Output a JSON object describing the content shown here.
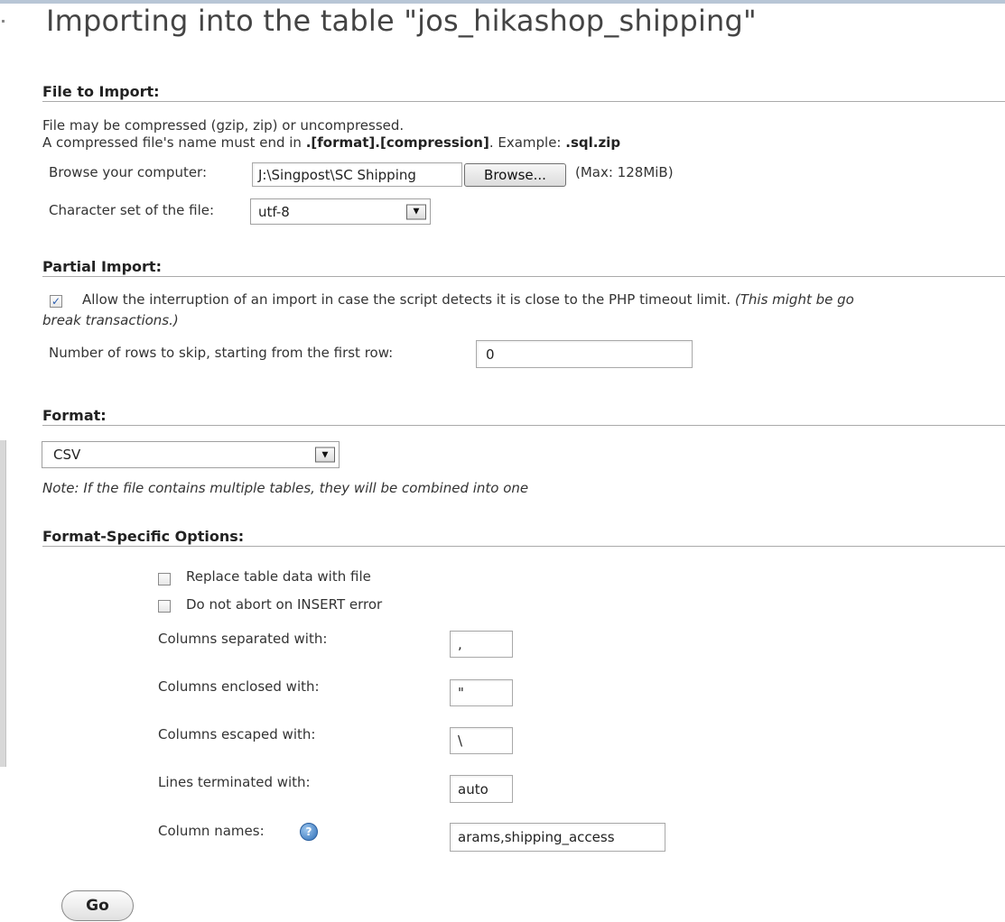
{
  "page_title": "Importing into the table \"jos_hikashop_shipping\"",
  "file_to_import": {
    "heading": "File to Import:",
    "line1": "File may be compressed (gzip, zip) or uncompressed.",
    "line2_prefix": "A compressed file's name must end in ",
    "line2_format": ".[format].[compression]",
    "line2_mid": ". Example: ",
    "line2_example": ".sql.zip",
    "browse_label": "Browse your computer:",
    "file_path": "J:\\Singpost\\SC Shipping",
    "browse_button": "Browse...",
    "max_size": "(Max: 128MiB)",
    "charset_label": "Character set of the file:",
    "charset_value": "utf-8"
  },
  "partial_import": {
    "heading": "Partial Import:",
    "allow_interruption_checked": true,
    "allow_interruption_text": "Allow the interruption of an import in case the script detects it is close to the PHP timeout limit.",
    "allow_interruption_note_1": "(This might be go",
    "allow_interruption_note_2": "break transactions.)",
    "skip_rows_label": "Number of rows to skip, starting from the first row:",
    "skip_rows_value": "0"
  },
  "format": {
    "heading": "Format:",
    "selected": "CSV",
    "note": "Note: If the file contains multiple tables, they will be combined into one"
  },
  "format_options": {
    "heading": "Format-Specific Options:",
    "replace_label": "Replace table data with file",
    "replace_checked": false,
    "ignore_label": "Do not abort on INSERT error",
    "ignore_checked": false,
    "sep_label": "Columns separated with:",
    "sep_value": ",",
    "enc_label": "Columns enclosed with:",
    "enc_value": "\"",
    "esc_label": "Columns escaped with:",
    "esc_value": "\\",
    "term_label": "Lines terminated with:",
    "term_value": "auto",
    "names_label": "Column names:",
    "names_value": "arams,shipping_access"
  },
  "go_button": "Go"
}
